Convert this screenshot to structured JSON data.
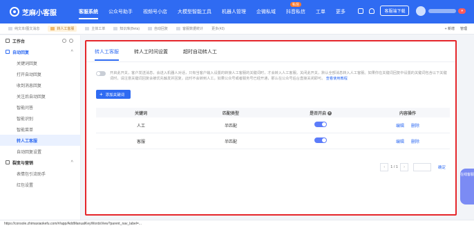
{
  "app": {
    "name": "芝麻小客服",
    "colors": {
      "primary": "#2f6bf2",
      "highlight": "#e5252a"
    }
  },
  "topnav": {
    "items": [
      "客服系统",
      "公众号助手",
      "视频号小店",
      "大模型智能工具",
      "机器人管理",
      "企微私域",
      "抖音私信",
      "工单",
      "更多"
    ],
    "badge": "私信",
    "download": "客服端下载",
    "version": "▾"
  },
  "tabbar": {
    "tabs": [
      "纯文本/图文消息",
      "转人工客服",
      "主体工单",
      "知识库(Beta)",
      "自动回复",
      "客服数据统计"
    ],
    "count": "更多(43)",
    "add": "+ 新增",
    "manage": "管理"
  },
  "sidebar": {
    "workbench": "工作台",
    "auto_reply": "自动回复",
    "items": [
      "关键词回复",
      "打开自动回复",
      "收到消息回复",
      "关注后自动回复",
      "智能问答",
      "智能识别",
      "智能菜单",
      "转人工客服",
      "自动回复设置"
    ],
    "marketing": "裂变与营销",
    "marketing_items": [
      "表情包引流助手",
      "红包设置"
    ]
  },
  "main": {
    "tabs": [
      "转人工客服",
      "转人工时间设置",
      "超时自动转人工"
    ],
    "description": "开启此开关，客户发送消息，会进入机器人对话，只有当客户输入设置的转接人工客服的关键词时，才会转入人工客服。关闭此开关，默认全部消息转入人工客服。如果你在关键词回复中设置的关键词包含以下关键词时，请注意关键词回复会被优先触发并回复，此时不会转到人工。如果公众号或者服务号已经开通，那么在公众号后台直接关闭即可。",
    "help_link": "查看使用教程",
    "add_button": "添加关键词",
    "table": {
      "headers": [
        "关键词",
        "匹配类型",
        "是否开启",
        "内容操作"
      ],
      "rows": [
        {
          "keyword": "人工",
          "match": "半匹配",
          "edit": "编辑",
          "delete": "删除"
        },
        {
          "keyword": "客服",
          "match": "半匹配",
          "edit": "编辑",
          "delete": "删除"
        }
      ]
    },
    "pager": {
      "page": "1 / 1",
      "confirm": "确定"
    }
  },
  "float": {
    "label": "在线客服"
  },
  "statusbar": {
    "url": "https://console.zhimaxiaokefu.com/#/app/AddManualKeyWordsView?parent_nav_label=..."
  }
}
